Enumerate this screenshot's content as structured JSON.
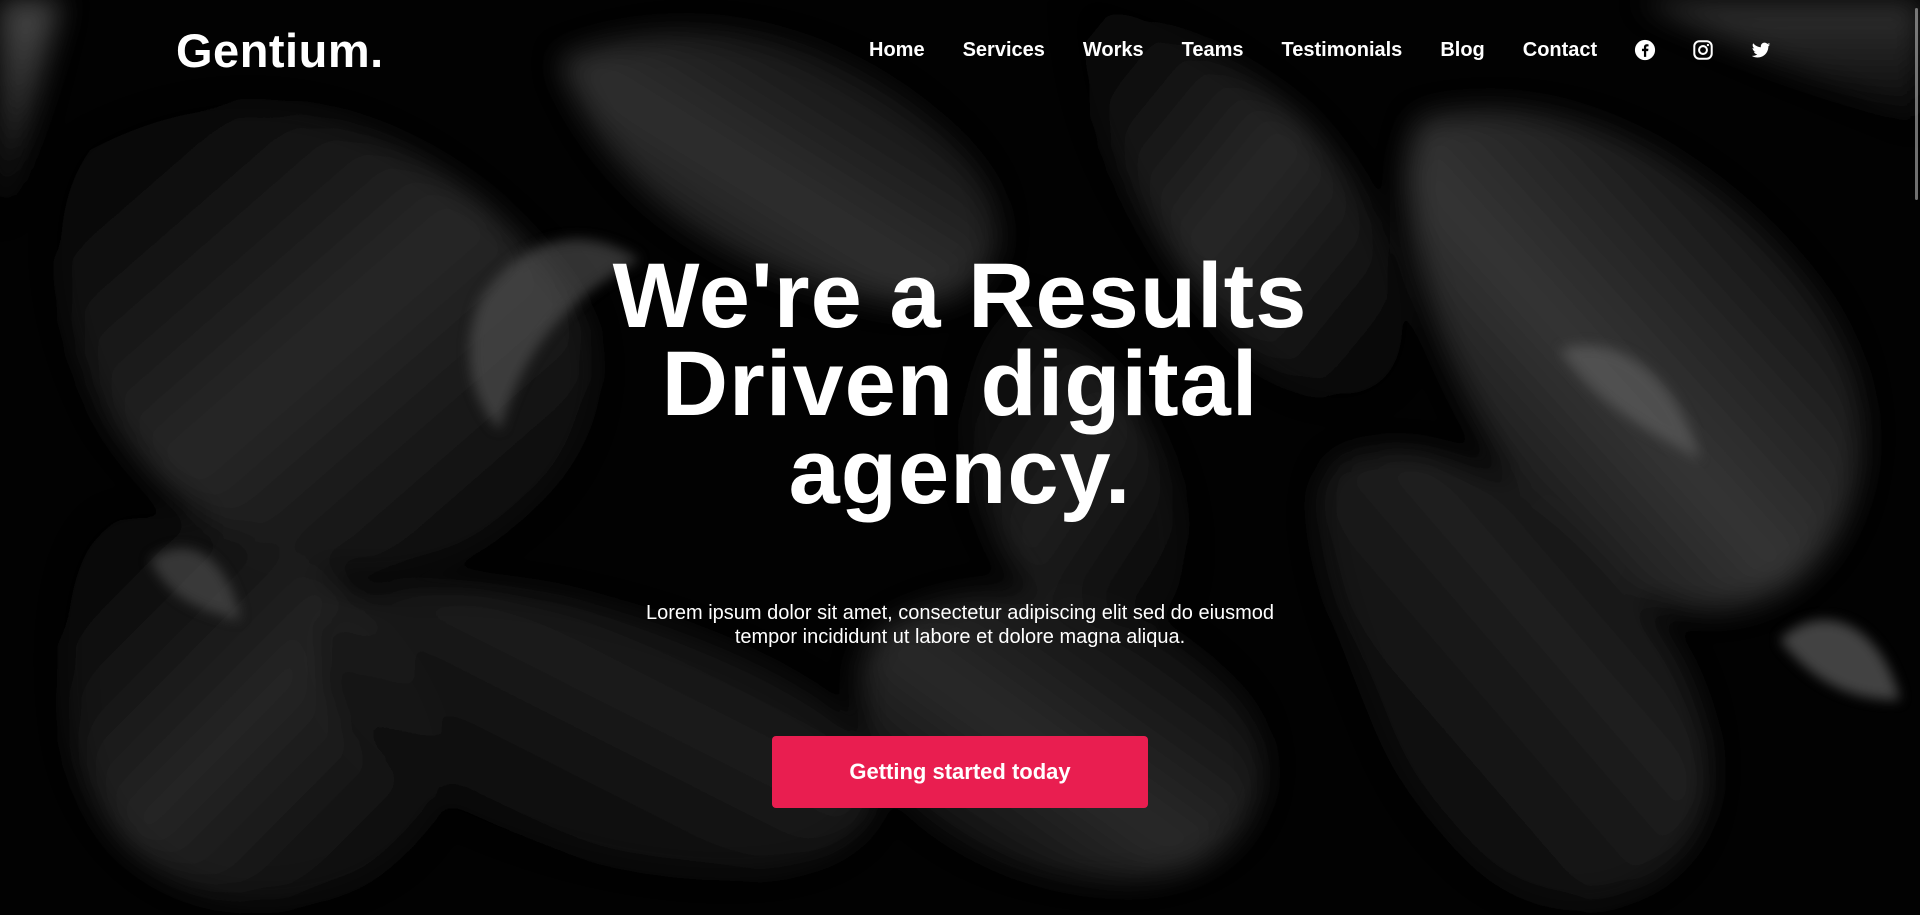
{
  "header": {
    "logo": "Gentium.",
    "nav": [
      {
        "label": "Home"
      },
      {
        "label": "Services"
      },
      {
        "label": "Works"
      },
      {
        "label": "Teams"
      },
      {
        "label": "Testimonials"
      },
      {
        "label": "Blog"
      },
      {
        "label": "Contact"
      }
    ],
    "social": [
      {
        "icon": "facebook-icon"
      },
      {
        "icon": "instagram-icon"
      },
      {
        "icon": "twitter-icon"
      }
    ]
  },
  "hero": {
    "title": "We're a Results Driven digital agency.",
    "description": "Lorem ipsum dolor sit amet, consectetur adipiscing elit sed do eiusmod tempor incididunt ut labore et dolore magna aliqua.",
    "cta_label": "Getting started today"
  },
  "colors": {
    "background": "#000000",
    "text": "#ffffff",
    "accent": "#e91e50"
  }
}
